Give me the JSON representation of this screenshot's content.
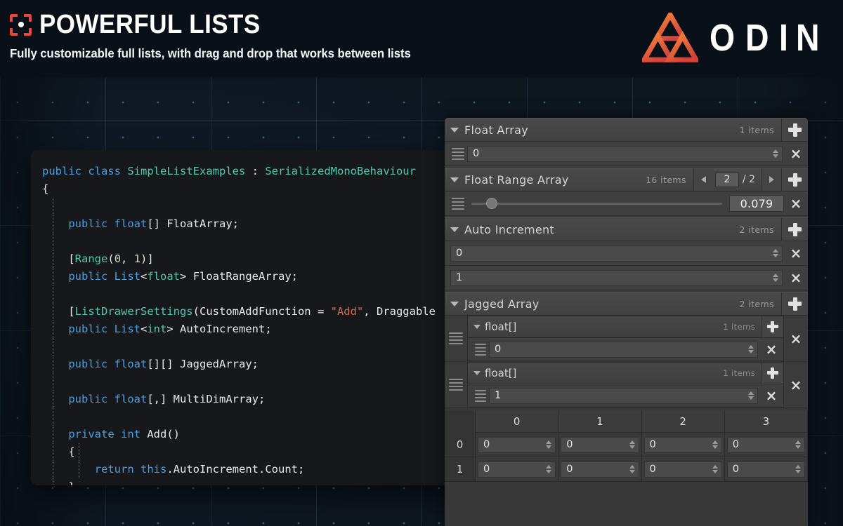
{
  "header": {
    "brand_icon": "target-brackets-icon",
    "title": "POWERFUL LISTS",
    "subtitle": "Fully customizable full lists, with drag and drop that works between lists",
    "logo_mark": "odin-valknut-icon",
    "logo_letters": [
      "O",
      "D",
      "I",
      "N"
    ],
    "accent_color": "#e8453c",
    "logo_gradient_from": "#f07a3a",
    "logo_gradient_to": "#d9473c"
  },
  "code": {
    "language": "csharp",
    "lines": [
      [
        {
          "t": "public",
          "c": "kw"
        },
        {
          "t": " ",
          "c": "plain"
        },
        {
          "t": "class",
          "c": "kw"
        },
        {
          "t": " ",
          "c": "plain"
        },
        {
          "t": "SimpleListExamples",
          "c": "type"
        },
        {
          "t": " : ",
          "c": "plain"
        },
        {
          "t": "SerializedMonoBehaviour",
          "c": "type"
        }
      ],
      [
        {
          "t": "{",
          "c": "plain"
        }
      ],
      [],
      [
        {
          "t": "    ",
          "c": "plain"
        },
        {
          "t": "public",
          "c": "kw"
        },
        {
          "t": " ",
          "c": "plain"
        },
        {
          "t": "float",
          "c": "kw"
        },
        {
          "t": "[] ",
          "c": "plain"
        },
        {
          "t": "FloatArray",
          "c": "plain"
        },
        {
          "t": ";",
          "c": "plain"
        }
      ],
      [],
      [
        {
          "t": "    [",
          "c": "plain"
        },
        {
          "t": "Range",
          "c": "attr"
        },
        {
          "t": "(",
          "c": "plain"
        },
        {
          "t": "0",
          "c": "num"
        },
        {
          "t": ", ",
          "c": "plain"
        },
        {
          "t": "1",
          "c": "num"
        },
        {
          "t": ")]",
          "c": "plain"
        }
      ],
      [
        {
          "t": "    ",
          "c": "plain"
        },
        {
          "t": "public",
          "c": "kw"
        },
        {
          "t": " ",
          "c": "plain"
        },
        {
          "t": "List",
          "c": "kw"
        },
        {
          "t": "<",
          "c": "plain"
        },
        {
          "t": "float",
          "c": "type"
        },
        {
          "t": "> ",
          "c": "plain"
        },
        {
          "t": "FloatRangeArray",
          "c": "plain"
        },
        {
          "t": ";",
          "c": "plain"
        }
      ],
      [],
      [
        {
          "t": "    [",
          "c": "plain"
        },
        {
          "t": "ListDrawerSettings",
          "c": "attr"
        },
        {
          "t": "(CustomAddFunction = ",
          "c": "plain"
        },
        {
          "t": "\"Add\"",
          "c": "str"
        },
        {
          "t": ", Draggable",
          "c": "plain"
        }
      ],
      [
        {
          "t": "    ",
          "c": "plain"
        },
        {
          "t": "public",
          "c": "kw"
        },
        {
          "t": " ",
          "c": "plain"
        },
        {
          "t": "List",
          "c": "kw"
        },
        {
          "t": "<",
          "c": "plain"
        },
        {
          "t": "int",
          "c": "type"
        },
        {
          "t": "> ",
          "c": "plain"
        },
        {
          "t": "AutoIncrement",
          "c": "plain"
        },
        {
          "t": ";",
          "c": "plain"
        }
      ],
      [],
      [
        {
          "t": "    ",
          "c": "plain"
        },
        {
          "t": "public",
          "c": "kw"
        },
        {
          "t": " ",
          "c": "plain"
        },
        {
          "t": "float",
          "c": "kw"
        },
        {
          "t": "[][] ",
          "c": "plain"
        },
        {
          "t": "JaggedArray",
          "c": "plain"
        },
        {
          "t": ";",
          "c": "plain"
        }
      ],
      [],
      [
        {
          "t": "    ",
          "c": "plain"
        },
        {
          "t": "public",
          "c": "kw"
        },
        {
          "t": " ",
          "c": "plain"
        },
        {
          "t": "float",
          "c": "kw"
        },
        {
          "t": "[,] ",
          "c": "plain"
        },
        {
          "t": "MultiDimArray",
          "c": "plain"
        },
        {
          "t": ";",
          "c": "plain"
        }
      ],
      [],
      [
        {
          "t": "    ",
          "c": "plain"
        },
        {
          "t": "private",
          "c": "kw"
        },
        {
          "t": " ",
          "c": "plain"
        },
        {
          "t": "int",
          "c": "kw"
        },
        {
          "t": " ",
          "c": "plain"
        },
        {
          "t": "Add",
          "c": "plain"
        },
        {
          "t": "()",
          "c": "plain"
        }
      ],
      [
        {
          "t": "    {",
          "c": "plain"
        }
      ],
      [
        {
          "t": "        ",
          "c": "plain"
        },
        {
          "t": "return",
          "c": "kw"
        },
        {
          "t": " ",
          "c": "plain"
        },
        {
          "t": "this",
          "c": "kw"
        },
        {
          "t": ".",
          "c": "plain"
        },
        {
          "t": "AutoIncrement",
          "c": "plain"
        },
        {
          "t": ".",
          "c": "plain"
        },
        {
          "t": "Count",
          "c": "plain"
        },
        {
          "t": ";",
          "c": "plain"
        }
      ],
      [
        {
          "t": "    }",
          "c": "plain"
        }
      ],
      [
        {
          "t": "}",
          "c": "plain"
        }
      ]
    ]
  },
  "inspector": {
    "lists": [
      {
        "name": "float-array",
        "title": "Float Array",
        "items_count": "1 items",
        "add_label": "+",
        "remove_label": "×",
        "draggable": true,
        "rows": [
          {
            "value": "0"
          }
        ]
      },
      {
        "name": "float-range-array",
        "title": "Float Range Array",
        "items_count": "16 items",
        "add_label": "+",
        "remove_label": "×",
        "draggable": true,
        "pager": {
          "page": "2",
          "total": "/ 2",
          "prev": "◀",
          "next": "▶"
        },
        "slider_rows": [
          {
            "value": "0.079",
            "fill_percent": 8
          }
        ]
      },
      {
        "name": "auto-increment",
        "title": "Auto Increment",
        "items_count": "2 items",
        "add_label": "+",
        "remove_label": "×",
        "draggable": false,
        "rows": [
          {
            "value": "0"
          },
          {
            "value": "1"
          }
        ]
      },
      {
        "name": "jagged-array",
        "title": "Jagged Array",
        "items_count": "2 items",
        "add_label": "+",
        "remove_label": "×",
        "draggable": true,
        "nested": [
          {
            "title": "float[]",
            "items_count": "1 items",
            "add_label": "+",
            "remove_label": "×",
            "rows": [
              {
                "value": "0"
              }
            ]
          },
          {
            "title": "float[]",
            "items_count": "1 items",
            "add_label": "+",
            "remove_label": "×",
            "rows": [
              {
                "value": "1"
              }
            ]
          }
        ]
      }
    ],
    "matrix": {
      "name": "multi-dim-array",
      "col_headers": [
        "0",
        "1",
        "2",
        "3"
      ],
      "row_headers": [
        "0",
        "1"
      ],
      "cells": [
        [
          "0",
          "0",
          "0",
          "0"
        ],
        [
          "0",
          "0",
          "0",
          "0"
        ]
      ]
    }
  }
}
